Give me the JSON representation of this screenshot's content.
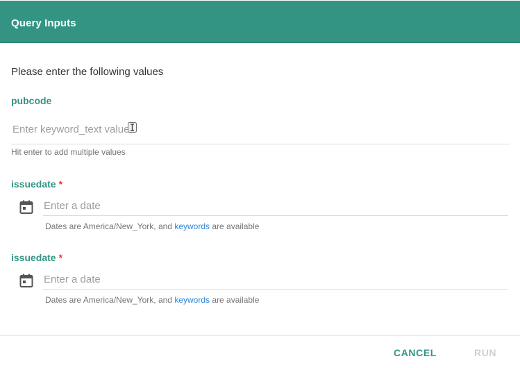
{
  "dialog": {
    "title": "Query Inputs",
    "intro": "Please enter the following values"
  },
  "fields": [
    {
      "label": "pubcode",
      "required": false,
      "placeholder": "Enter keyword_text values",
      "hint": "Hit enter to add multiple values"
    },
    {
      "label": "issuedate",
      "required": true,
      "required_mark": "*",
      "placeholder": "Enter a date",
      "help_prefix": "Dates are America/New_York, and ",
      "help_link": "keywords",
      "help_suffix": " are available"
    },
    {
      "label": "issuedate",
      "required": true,
      "required_mark": "*",
      "placeholder": "Enter a date",
      "help_prefix": "Dates are America/New_York, and ",
      "help_link": "keywords",
      "help_suffix": " are available"
    }
  ],
  "actions": {
    "cancel": "CANCEL",
    "run": "RUN"
  },
  "colors": {
    "header": "#349484",
    "accent": "#349484",
    "required": "#e53935",
    "link": "#2b86d9",
    "disabled": "#cfcfcf"
  },
  "icons": {
    "date_field": "calendar-icon",
    "cursor": "text-cursor-icon"
  }
}
